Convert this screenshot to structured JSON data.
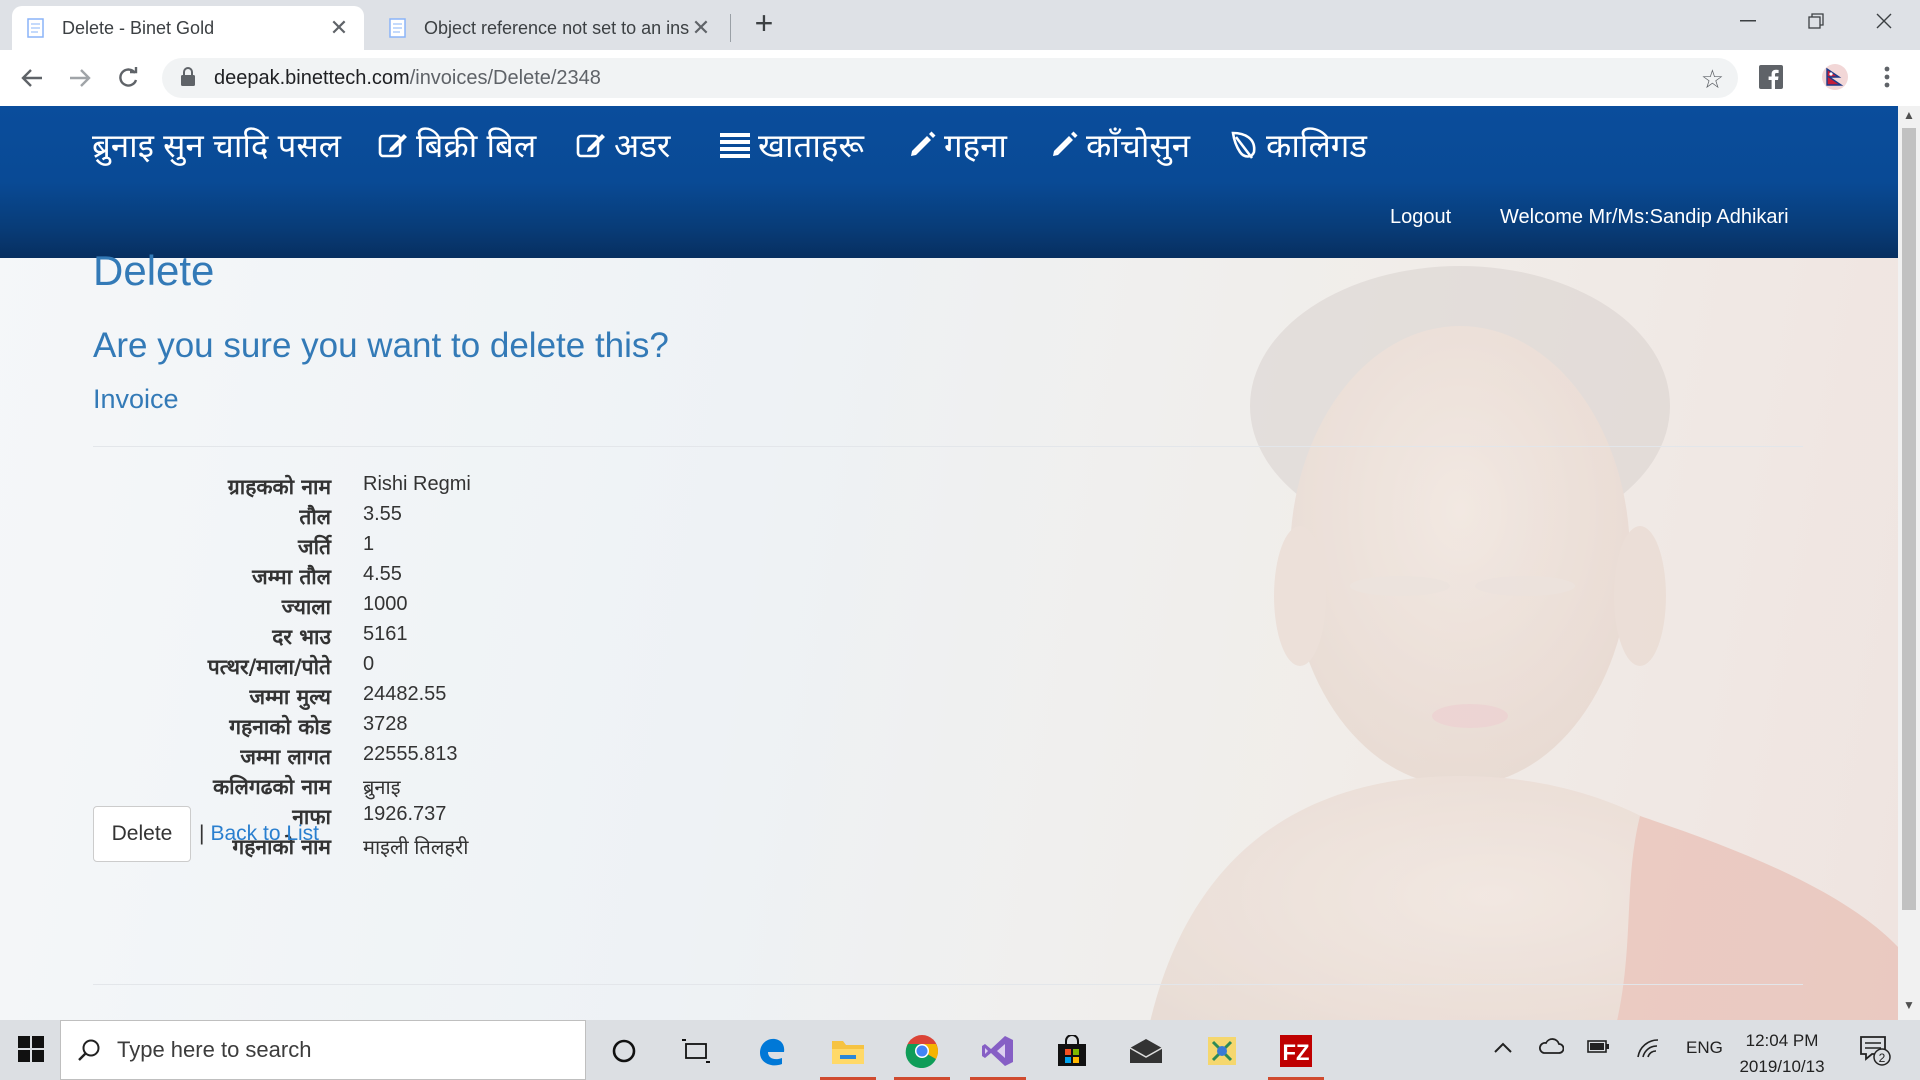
{
  "browser": {
    "tabs": [
      {
        "title": "Delete - Binet Gold",
        "active": true
      },
      {
        "title": "Object reference not set to an ins",
        "active": false
      }
    ],
    "url_domain": "deepak.binettech.com",
    "url_path": "/invoices/Delete/2348"
  },
  "navbar": {
    "brand": "ब्रुनाइ सुन चादि पसल",
    "items": [
      {
        "label": "बिक्री बिल",
        "icon": "edit-icon"
      },
      {
        "label": "अडर",
        "icon": "edit-icon"
      },
      {
        "label": "खाताहरू",
        "icon": "list-icon"
      },
      {
        "label": "गहना",
        "icon": "pencil-icon"
      },
      {
        "label": "काँचोसुन",
        "icon": "pencil-icon"
      },
      {
        "label": "कालिगड",
        "icon": "leaf-icon"
      }
    ],
    "logout": "Logout",
    "welcome": "Welcome Mr/Ms:Sandip Adhikari",
    "color": "#0a4d9c"
  },
  "page": {
    "heading": "Delete",
    "question": "Are you sure you want to delete this?",
    "subheading": "Invoice",
    "accent_color": "#337ab7",
    "fields": [
      {
        "label": "ग्राहकको नाम",
        "value": "Rishi Regmi"
      },
      {
        "label": "तौल",
        "value": "3.55"
      },
      {
        "label": "जर्ति",
        "value": "1"
      },
      {
        "label": "जम्मा तौल",
        "value": "4.55"
      },
      {
        "label": "ज्याला",
        "value": "1000"
      },
      {
        "label": "दर भाउ",
        "value": "5161"
      },
      {
        "label": "पत्थर/माला/पोते",
        "value": "0"
      },
      {
        "label": "जम्मा मुल्य",
        "value": "24482.55"
      },
      {
        "label": "गहनाको कोड",
        "value": "3728"
      },
      {
        "label": "जम्मा लागत",
        "value": "22555.813"
      },
      {
        "label": "कलिगढको नाम",
        "value": "ब्रुनाइ"
      },
      {
        "label": "नाफा",
        "value": "1926.737"
      },
      {
        "label": "गहनाको नाम",
        "value": "माइली तिलहरी"
      }
    ],
    "delete_button": "Delete",
    "separator": "|",
    "back_link": "Back to List"
  },
  "taskbar": {
    "search_placeholder": "Type here to search",
    "language": "ENG",
    "time": "12:04 PM",
    "date": "2019/10/13",
    "notification_count": "2"
  }
}
